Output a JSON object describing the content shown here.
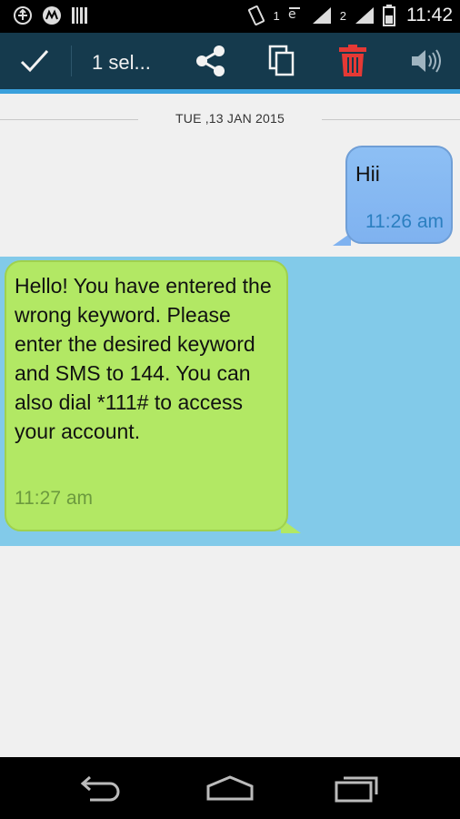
{
  "status_bar": {
    "sim1_label": "1",
    "sim2_label": "2",
    "time": "11:42",
    "icons": [
      "usb-icon",
      "motorola-icon",
      "barcode-icon",
      "vibrate-icon",
      "network-icon",
      "signal-icon",
      "battery-icon"
    ]
  },
  "action_bar": {
    "selected_label": "1 sel...",
    "icons": [
      "check-icon",
      "share-icon",
      "copy-icon",
      "delete-icon",
      "speaker-icon"
    ],
    "colors": {
      "background": "#153a4d",
      "accent": "#3aa0dc",
      "delete": "#e53935"
    }
  },
  "conversation": {
    "date": "TUE ,13 JAN 2015",
    "messages": [
      {
        "direction": "outgoing",
        "text": "Hii",
        "time": "11:26 am"
      },
      {
        "direction": "incoming",
        "text": "Hello! You have entered the wrong keyword. Please enter the desired keyword and SMS to 144. You can also dial *111# to access your account.",
        "time": "11:27 am",
        "selected": true
      }
    ],
    "colors": {
      "outgoing_bubble": "#8dbff4",
      "incoming_bubble": "#b2e864",
      "selection_band": "#82cae9"
    }
  },
  "nav_bar": {
    "icons": [
      "back-icon",
      "home-icon",
      "recents-icon"
    ]
  }
}
